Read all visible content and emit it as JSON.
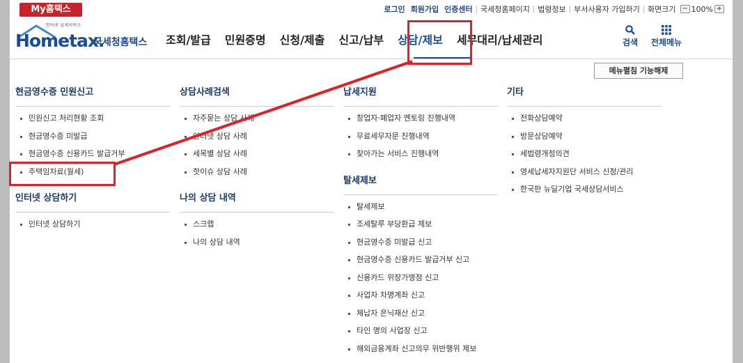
{
  "topbar": {
    "my_hometax": "My홈택스",
    "links": [
      "로그인",
      "회원가입",
      "인증센터",
      "국세청홈페이지",
      "법령정보",
      "부서사용자 가입하기",
      "화면크기"
    ],
    "zoom": "100%",
    "zoom_minus": "−",
    "zoom_plus": "+"
  },
  "logo": {
    "tagline": "인터넷 납세서비스",
    "brand": "Hometax.",
    "korean_name": "국세청홈택스"
  },
  "gnb": {
    "items": [
      "조회/발급",
      "민원증명",
      "신청/제출",
      "신고/납부",
      "상담/제보",
      "세무대리/납세관리"
    ],
    "active_index": 4
  },
  "header_icons": {
    "search": "검색",
    "all_menu": "전체메뉴"
  },
  "menu_toggle": "메뉴펼침 기능해제",
  "columns": [
    {
      "sections": [
        {
          "title": "현금영수증 민원신고",
          "items": [
            "민원신고 처리현황 조회",
            "현금영수증 미발급",
            "현금영수증 신용카드 발급거부",
            "주택임차료(월세)"
          ]
        },
        {
          "title": "인터넷 상담하기",
          "items": [
            "인터넷 상담하기"
          ]
        }
      ]
    },
    {
      "sections": [
        {
          "title": "상담사례검색",
          "items": [
            "자주묻는 상담 사례",
            "인터넷 상담 사례",
            "세목별 상담 사례",
            "핫이슈 상담 사례"
          ]
        },
        {
          "title": "나의 상담 내역",
          "items": [
            "스크랩",
            "나의 상담 내역"
          ]
        }
      ]
    },
    {
      "sections": [
        {
          "title": "납세지원",
          "items": [
            "창업자·폐업자 멘토링 진행내역",
            "무료세무자문 진행내역",
            "찾아가는 서비스 진행내역"
          ]
        },
        {
          "title": "탈세제보",
          "items": [
            "탈세제보",
            "조세탈루 부당환급 제보",
            "현금영수증 미발급 신고",
            "현금영수증 신용카드 발급거부 신고",
            "신용카드 위장가맹점 신고",
            "사업자 차명계좌 신고",
            "체납자 은닉재산 신고",
            "타인 명의 사업장 신고",
            "해외금융계좌 신고의무 위반행위 제보"
          ]
        }
      ]
    },
    {
      "sections": [
        {
          "title": "기타",
          "items": [
            "전화상담예약",
            "방문상담예약",
            "세법령개정의견",
            "영세납세자지원단 서비스 신청/관리",
            "한국판 뉴딜기업 국세상담서비스"
          ]
        }
      ]
    }
  ],
  "colors": {
    "brand_blue": "#1b4b91",
    "annotation_red": "#e01f26",
    "my_hometax_red": "#c8232c"
  }
}
